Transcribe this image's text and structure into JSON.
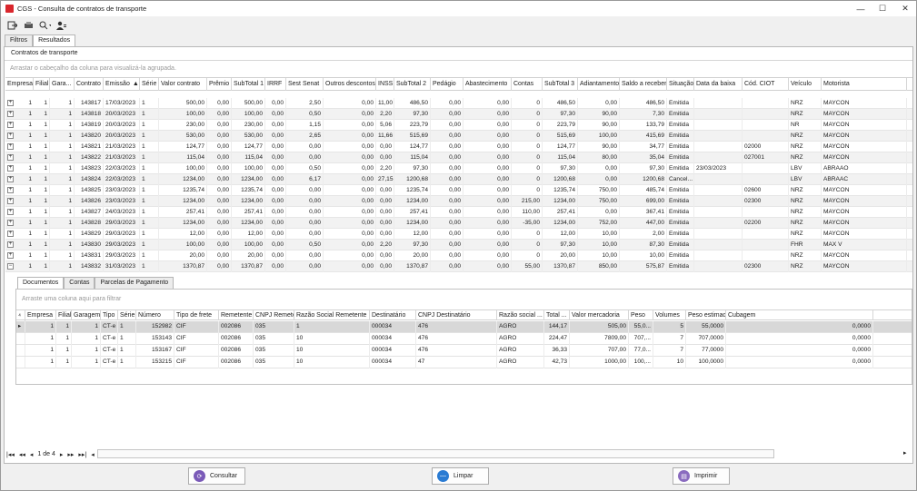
{
  "window": {
    "title": "CGS - Consulta de contratos de transporte",
    "minimize": "—",
    "maximize": "☐",
    "close": "✕"
  },
  "toolbar": {
    "icons": [
      "exit-icon",
      "print-icon",
      "search-icon",
      "user-icon"
    ]
  },
  "tabs": [
    "Filtros",
    "Resultados"
  ],
  "section_title": "Contratos de transporte",
  "group_hint": "Arrastar o cabeçalho da coluna para visualizá-la agrupada.",
  "columns": [
    "Empresa",
    "Filial",
    "Gara...",
    "Contrato",
    "Emissão",
    "Série",
    "Valor contrato",
    "Prêmio",
    "SubTotal 1",
    "IRRF",
    "Sest Senat",
    "Outros descontos",
    "INSS",
    "SubTotal 2",
    "Pedágio",
    "Abastecimento",
    "Contas",
    "SubTotal 3",
    "Adiantamento",
    "Saldo a receber",
    "Situação",
    "Data da baixa",
    "Cód. CIOT",
    "Veículo",
    "Motorista"
  ],
  "sort_indicator": "▲",
  "rows": [
    [
      "1",
      "1",
      "1",
      "143817",
      "17/03/2023",
      "1",
      "500,00",
      "0,00",
      "500,00",
      "0,00",
      "2,50",
      "0,00",
      "11,00",
      "486,50",
      "0,00",
      "0,00",
      "0",
      "486,50",
      "0,00",
      "486,50",
      "Emitida",
      "",
      "",
      "NRZ",
      "MAYCON"
    ],
    [
      "1",
      "1",
      "1",
      "143818",
      "20/03/2023",
      "1",
      "100,00",
      "0,00",
      "100,00",
      "0,00",
      "0,50",
      "0,00",
      "2,20",
      "97,30",
      "0,00",
      "0,00",
      "0",
      "97,30",
      "90,00",
      "7,30",
      "Emitida",
      "",
      "",
      "NRZ",
      "MAYCON"
    ],
    [
      "1",
      "1",
      "1",
      "143819",
      "20/03/2023",
      "1",
      "230,00",
      "0,00",
      "230,00",
      "0,00",
      "1,15",
      "0,00",
      "5,06",
      "223,79",
      "0,00",
      "0,00",
      "0",
      "223,79",
      "90,00",
      "133,79",
      "Emitida",
      "",
      "",
      "NR",
      "MAYCON"
    ],
    [
      "1",
      "1",
      "1",
      "143820",
      "20/03/2023",
      "1",
      "530,00",
      "0,00",
      "530,00",
      "0,00",
      "2,65",
      "0,00",
      "11,66",
      "515,69",
      "0,00",
      "0,00",
      "0",
      "515,69",
      "100,00",
      "415,69",
      "Emitida",
      "",
      "",
      "NRZ",
      "MAYCON"
    ],
    [
      "1",
      "1",
      "1",
      "143821",
      "21/03/2023",
      "1",
      "124,77",
      "0,00",
      "124,77",
      "0,00",
      "0,00",
      "0,00",
      "0,00",
      "124,77",
      "0,00",
      "0,00",
      "0",
      "124,77",
      "90,00",
      "34,77",
      "Emitida",
      "",
      "02000",
      "NRZ",
      "MAYCON"
    ],
    [
      "1",
      "1",
      "1",
      "143822",
      "21/03/2023",
      "1",
      "115,04",
      "0,00",
      "115,04",
      "0,00",
      "0,00",
      "0,00",
      "0,00",
      "115,04",
      "0,00",
      "0,00",
      "0",
      "115,04",
      "80,00",
      "35,04",
      "Emitida",
      "",
      "027001",
      "NRZ",
      "MAYCON"
    ],
    [
      "1",
      "1",
      "1",
      "143823",
      "22/03/2023",
      "1",
      "100,00",
      "0,00",
      "100,00",
      "0,00",
      "0,50",
      "0,00",
      "2,20",
      "97,30",
      "0,00",
      "0,00",
      "0",
      "97,30",
      "0,00",
      "97,30",
      "Emitida",
      "23/03/2023",
      "",
      "LBV",
      "ABRAAO"
    ],
    [
      "1",
      "1",
      "1",
      "143824",
      "22/03/2023",
      "1",
      "1234,00",
      "0,00",
      "1234,00",
      "0,00",
      "6,17",
      "0,00",
      "27,15",
      "1200,68",
      "0,00",
      "0,00",
      "0",
      "1200,68",
      "0,00",
      "1200,68",
      "Cancel...",
      "",
      "",
      "LBV",
      "ABRAAC"
    ],
    [
      "1",
      "1",
      "1",
      "143825",
      "23/03/2023",
      "1",
      "1235,74",
      "0,00",
      "1235,74",
      "0,00",
      "0,00",
      "0,00",
      "0,00",
      "1235,74",
      "0,00",
      "0,00",
      "0",
      "1235,74",
      "750,00",
      "485,74",
      "Emitida",
      "",
      "02600",
      "NRZ",
      "MAYCON"
    ],
    [
      "1",
      "1",
      "1",
      "143826",
      "23/03/2023",
      "1",
      "1234,00",
      "0,00",
      "1234,00",
      "0,00",
      "0,00",
      "0,00",
      "0,00",
      "1234,00",
      "0,00",
      "0,00",
      "215,00",
      "1234,00",
      "750,00",
      "699,00",
      "Emitida",
      "",
      "02300",
      "NRZ",
      "MAYCON"
    ],
    [
      "1",
      "1",
      "1",
      "143827",
      "24/03/2023",
      "1",
      "257,41",
      "0,00",
      "257,41",
      "0,00",
      "0,00",
      "0,00",
      "0,00",
      "257,41",
      "0,00",
      "0,00",
      "110,00",
      "257,41",
      "0,00",
      "367,41",
      "Emitida",
      "",
      "",
      "NRZ",
      "MAYCON"
    ],
    [
      "1",
      "1",
      "1",
      "143828",
      "29/03/2023",
      "1",
      "1234,00",
      "0,00",
      "1234,00",
      "0,00",
      "0,00",
      "0,00",
      "0,00",
      "1234,00",
      "0,00",
      "0,00",
      "-35,00",
      "1234,00",
      "752,00",
      "447,00",
      "Emitida",
      "",
      "02200",
      "NRZ",
      "MAYCON"
    ],
    [
      "1",
      "1",
      "1",
      "143829",
      "29/03/2023",
      "1",
      "12,00",
      "0,00",
      "12,00",
      "0,00",
      "0,00",
      "0,00",
      "0,00",
      "12,00",
      "0,00",
      "0,00",
      "0",
      "12,00",
      "10,00",
      "2,00",
      "Emitida",
      "",
      "",
      "NRZ",
      "MAYCON"
    ],
    [
      "1",
      "1",
      "1",
      "143830",
      "29/03/2023",
      "1",
      "100,00",
      "0,00",
      "100,00",
      "0,00",
      "0,50",
      "0,00",
      "2,20",
      "97,30",
      "0,00",
      "0,00",
      "0",
      "97,30",
      "10,00",
      "87,30",
      "Emitida",
      "",
      "",
      "FHR",
      "MAX V"
    ],
    [
      "1",
      "1",
      "1",
      "143831",
      "29/03/2023",
      "1",
      "20,00",
      "0,00",
      "20,00",
      "0,00",
      "0,00",
      "0,00",
      "0,00",
      "20,00",
      "0,00",
      "0,00",
      "0",
      "20,00",
      "10,00",
      "10,00",
      "Emitida",
      "",
      "",
      "NRZ",
      "MAYCON"
    ],
    [
      "1",
      "1",
      "1",
      "143832",
      "31/03/2023",
      "1",
      "1370,87",
      "0,00",
      "1370,87",
      "0,00",
      "0,00",
      "0,00",
      "0,00",
      "1370,87",
      "0,00",
      "0,00",
      "55,00",
      "1370,87",
      "850,00",
      "575,87",
      "Emitida",
      "",
      "02300",
      "NRZ",
      "MAYCON"
    ]
  ],
  "detail": {
    "tabs": [
      "Documentos",
      "Contas",
      "Parcelas de Pagamento"
    ],
    "hint": "Arraste uma coluna aqui para filtrar",
    "columns": [
      "Empresa",
      "Filial",
      "Garagem",
      "Tipo",
      "Série",
      "Número",
      "Tipo de frete",
      "Remetente",
      "CNPJ Remetente",
      "Razão Social Remetente",
      "Destinatário",
      "CNPJ Destinatário",
      "Razão social ...",
      "Total ...",
      "Valor mercadoria",
      "Peso",
      "Volumes",
      "Peso estimado",
      "Cubagem"
    ],
    "rows": [
      [
        "1",
        "1",
        "1",
        "CT-e",
        "1",
        "152982",
        "CIF",
        "002086",
        "035",
        "1",
        "000034",
        "476",
        "AGRO",
        "144,17",
        "505,00",
        "55,0...",
        "5",
        "55,0000",
        "0,0000"
      ],
      [
        "1",
        "1",
        "1",
        "CT-e",
        "1",
        "153143",
        "CIF",
        "002086",
        "035",
        "10",
        "000034",
        "476",
        "AGRO",
        "224,47",
        "7809,00",
        "707,...",
        "7",
        "707,0000",
        "0,0000"
      ],
      [
        "1",
        "1",
        "1",
        "CT-e",
        "1",
        "153167",
        "CIF",
        "002086",
        "035",
        "10",
        "000034",
        "476",
        "AGRO",
        "36,33",
        "707,00",
        "77,0...",
        "7",
        "77,0000",
        "0,0000"
      ],
      [
        "1",
        "1",
        "1",
        "CT-e",
        "1",
        "153215",
        "CIF",
        "002086",
        "035",
        "10",
        "000034",
        "47",
        "AGRO",
        "42,73",
        "1000,00",
        "100,...",
        "10",
        "100,0000",
        "0,0000"
      ]
    ]
  },
  "pager": {
    "text": "1 de 4"
  },
  "buttons": {
    "consultar": "Consultar",
    "limpar": "Limpar",
    "imprimir": "Imprimir"
  }
}
